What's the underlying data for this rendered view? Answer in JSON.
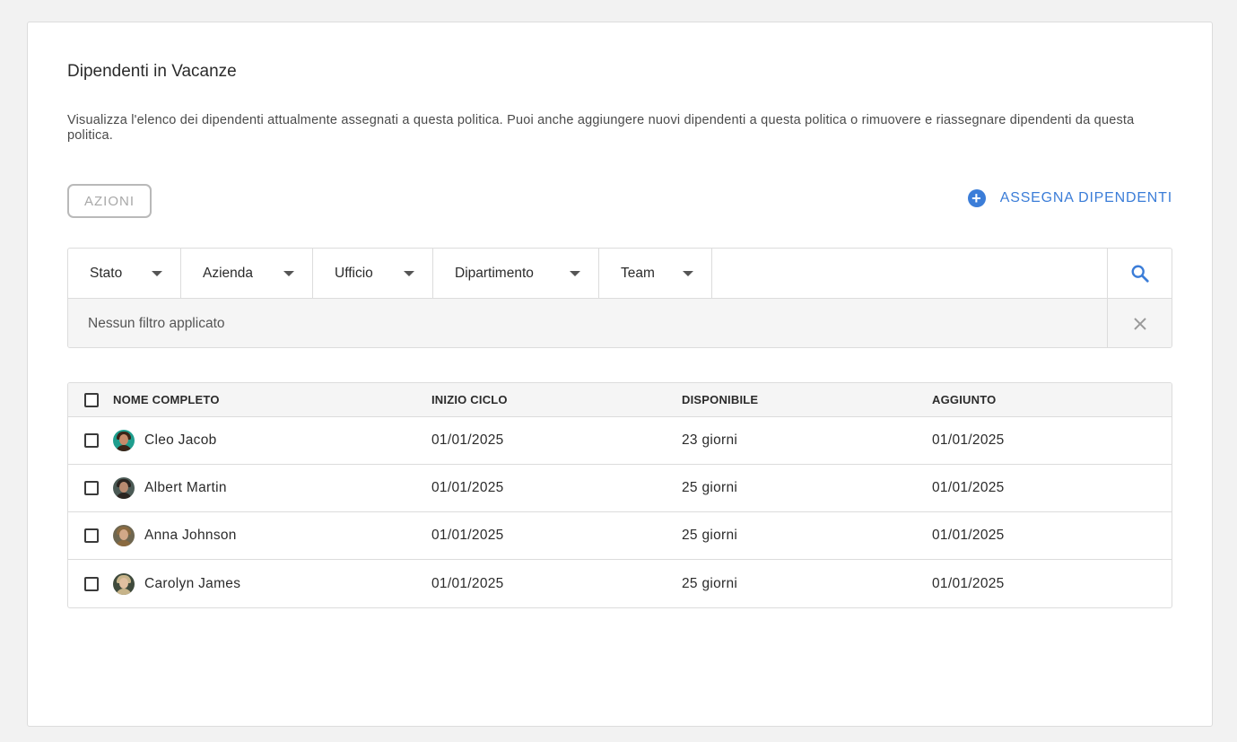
{
  "page": {
    "title": "Dipendenti in Vacanze",
    "description": "Visualizza l'elenco dei dipendenti attualmente assegnati a questa politica. Puoi anche aggiungere nuovi dipendenti a questa politica o rimuovere e riassegnare dipendenti da questa politica."
  },
  "toolbar": {
    "actions_label": "AZIONI",
    "assign_label": "ASSEGNA DIPENDENTI",
    "assign_icon": "plus-circle-icon",
    "accent_color": "#3b7dd8"
  },
  "filters": {
    "dropdowns": [
      {
        "label": "Stato"
      },
      {
        "label": "Azienda"
      },
      {
        "label": "Ufficio"
      },
      {
        "label": "Dipartimento"
      },
      {
        "label": "Team"
      }
    ],
    "search_icon": "search-icon",
    "clear_icon": "close-icon",
    "status_text": "Nessun filtro applicato"
  },
  "table": {
    "columns": [
      "NOME COMPLETO",
      "INIZIO CICLO",
      "DISPONIBILE",
      "AGGIUNTO"
    ],
    "rows": [
      {
        "name": "Cleo Jacob",
        "start": "01/01/2025",
        "available": "23 giorni",
        "added": "01/01/2025",
        "avatar_bg": "#1f9e8e",
        "avatar_hair": "#3b2418",
        "avatar_face": "#c88a6a"
      },
      {
        "name": "Albert Martin",
        "start": "01/01/2025",
        "available": "25 giorni",
        "added": "01/01/2025",
        "avatar_bg": "#4b5a55",
        "avatar_hair": "#2a2420",
        "avatar_face": "#b98a70"
      },
      {
        "name": "Anna Johnson",
        "start": "01/01/2025",
        "available": "25 giorni",
        "added": "01/01/2025",
        "avatar_bg": "#6e6650",
        "avatar_hair": "#8a6a40",
        "avatar_face": "#d2a888"
      },
      {
        "name": "Carolyn James",
        "start": "01/01/2025",
        "available": "25 giorni",
        "added": "01/01/2025",
        "avatar_bg": "#3f4a3c",
        "avatar_hair": "#c7b48a",
        "avatar_face": "#e0bfa0"
      }
    ]
  }
}
